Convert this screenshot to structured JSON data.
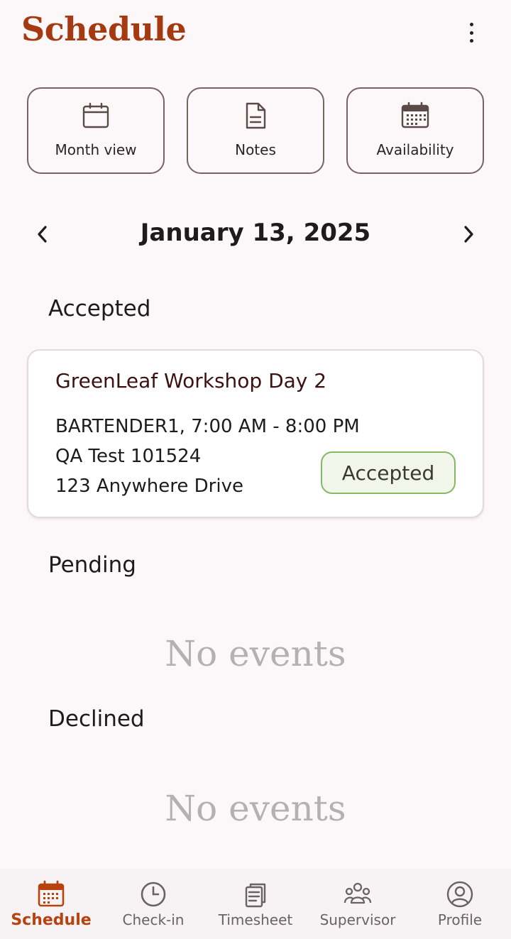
{
  "header": {
    "title": "Schedule",
    "menu_icon": "more-vert-icon"
  },
  "quick_actions": [
    {
      "label": "Month view",
      "icon": "calendar-icon"
    },
    {
      "label": "Notes",
      "icon": "document-icon"
    },
    {
      "label": "Availability",
      "icon": "calendar-grid-icon"
    }
  ],
  "date_nav": {
    "date": "January 13, 2025",
    "prev_icon": "chevron-left-icon",
    "next_icon": "chevron-right-icon"
  },
  "sections": {
    "accepted": {
      "title": "Accepted",
      "events": [
        {
          "name": "GreenLeaf Workshop Day 2",
          "role_time": "BARTENDER1, 7:00 AM - 8:00 PM",
          "venue": "QA Test 101524",
          "address": "123 Anywhere Drive",
          "status": "Accepted"
        }
      ]
    },
    "pending": {
      "title": "Pending",
      "empty": "No events"
    },
    "declined": {
      "title": "Declined",
      "empty": "No events"
    }
  },
  "bottom_nav": {
    "active": "Schedule",
    "items": [
      {
        "label": "Schedule",
        "icon": "calendar-icon"
      },
      {
        "label": "Check-in",
        "icon": "clock-icon"
      },
      {
        "label": "Timesheet",
        "icon": "clipboard-icon"
      },
      {
        "label": "Supervisor",
        "icon": "group-icon"
      },
      {
        "label": "Profile",
        "icon": "account-circle-icon"
      }
    ]
  },
  "colors": {
    "brand": "#a53a10",
    "background": "#fcf8fa",
    "accepted_border": "#86b865",
    "accepted_fill": "#f2f5e9",
    "empty_text": "#b5b1b2"
  }
}
